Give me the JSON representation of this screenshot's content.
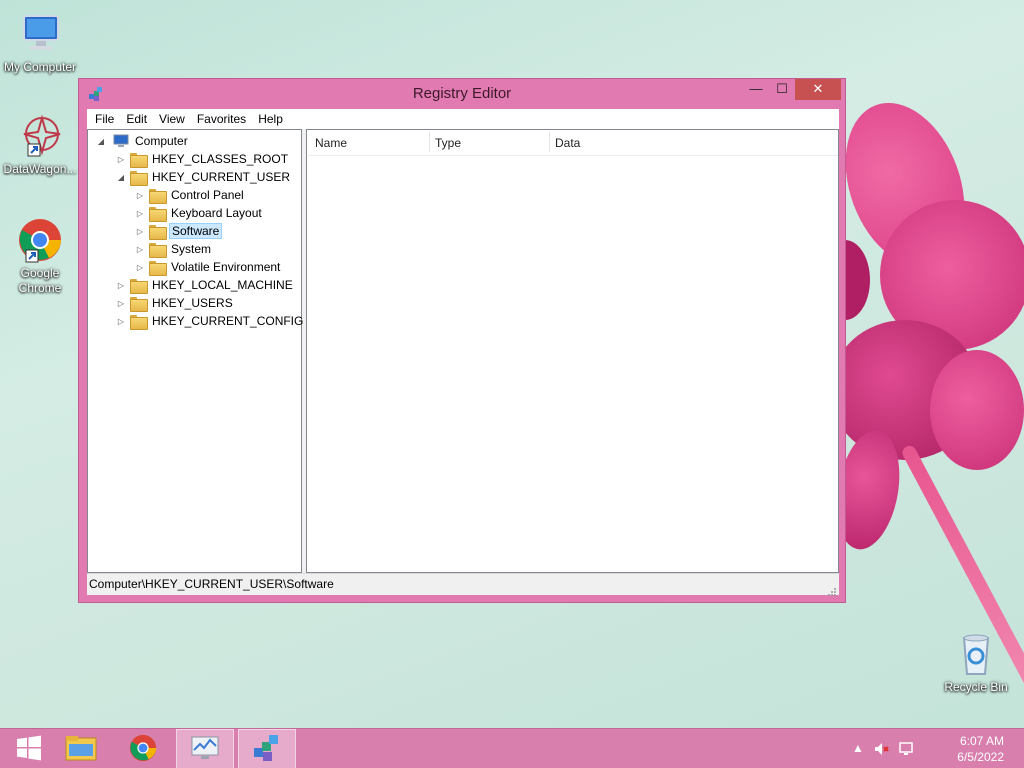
{
  "desktop": {
    "icons": [
      {
        "label": "My Computer"
      },
      {
        "label": "DataWagon..."
      },
      {
        "label": "Google Chrome"
      },
      {
        "label": "Recycle Bin"
      }
    ]
  },
  "window": {
    "title": "Registry Editor",
    "controls": {
      "minimize": "—",
      "maximize": "☐",
      "close": "✕"
    },
    "menu": [
      "File",
      "Edit",
      "View",
      "Favorites",
      "Help"
    ],
    "tree": {
      "root": "Computer",
      "hives": [
        {
          "label": "HKEY_CLASSES_ROOT"
        },
        {
          "label": "HKEY_CURRENT_USER",
          "children": [
            {
              "label": "Control Panel"
            },
            {
              "label": "Keyboard Layout"
            },
            {
              "label": "Software",
              "selected": true
            },
            {
              "label": "System"
            },
            {
              "label": "Volatile Environment"
            }
          ]
        },
        {
          "label": "HKEY_LOCAL_MACHINE"
        },
        {
          "label": "HKEY_USERS"
        },
        {
          "label": "HKEY_CURRENT_CONFIG"
        }
      ]
    },
    "list": {
      "columns": [
        "Name",
        "Type",
        "Data"
      ]
    },
    "status": "Computer\\HKEY_CURRENT_USER\\Software"
  },
  "taskbar": {
    "buttons": [
      "start-icon",
      "file-explorer-icon",
      "chrome-icon",
      "performance-monitor-icon",
      "registry-editor-icon"
    ],
    "clock": {
      "time": "6:07 AM",
      "date": "6/5/2022"
    }
  },
  "colors": {
    "window_frame": "#e07ab0",
    "taskbar": "#d97fae",
    "selection": "#cce8ff",
    "close_button": "#c75050"
  }
}
